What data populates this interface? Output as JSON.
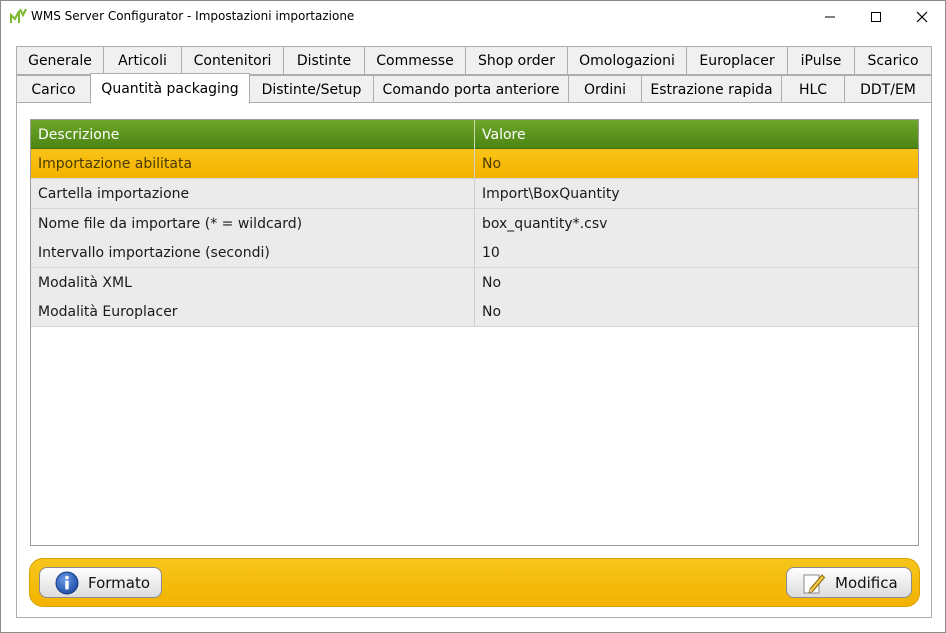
{
  "window": {
    "title": "WMS Server Configurator - Impostazioni importazione",
    "icon": "app-logo-icon",
    "controls": [
      "minimize-icon",
      "maximize-icon",
      "close-icon"
    ]
  },
  "tabs": {
    "row_top": [
      "Generale",
      "Articoli",
      "Contenitori",
      "Distinte",
      "Commesse",
      "Shop order",
      "Omologazioni",
      "Europlacer",
      "iPulse",
      "Scarico"
    ],
    "row_bottom": [
      "Carico",
      "Quantità packaging",
      "Distinte/Setup",
      "Comando porta anteriore",
      "Ordini",
      "Estrazione rapida",
      "HLC",
      "DDT/EM"
    ],
    "active": "Quantità packaging"
  },
  "grid": {
    "columns": [
      "Descrizione",
      "Valore"
    ],
    "rows": [
      {
        "description": "Importazione abilitata",
        "value": "No",
        "selected": true
      },
      {
        "description": "Cartella importazione",
        "value": "Import\\BoxQuantity",
        "selected": false
      },
      {
        "description": "Nome file da importare (* = wildcard)",
        "value": "box_quantity*.csv",
        "selected": false
      },
      {
        "description": "Intervallo importazione (secondi)",
        "value": "10",
        "selected": false
      },
      {
        "description": "Modalità XML",
        "value": "No",
        "selected": false
      },
      {
        "description": "Modalità Europlacer",
        "value": "No",
        "selected": false
      }
    ]
  },
  "toolbar": {
    "format_label": "Formato",
    "format_icon": "info-icon",
    "edit_label": "Modifica",
    "edit_icon": "pencil-icon"
  },
  "colors": {
    "header_green": "#4b8513",
    "selection_yellow": "#f5b100",
    "toolbar_yellow": "#f2b300"
  }
}
